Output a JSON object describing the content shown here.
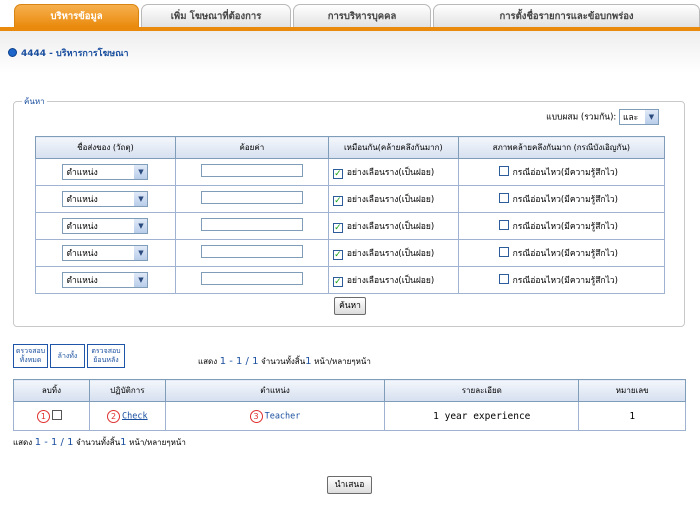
{
  "tabs": [
    {
      "label": "บริหารข้อมูล",
      "active": true
    },
    {
      "label": "เพิ่ม โฆษณาที่ต้องการ",
      "active": false
    },
    {
      "label": "การบริหารบุคคล",
      "active": false
    },
    {
      "label": "การตั้งชื่อรายการและข้อบกพร่อง",
      "active": false
    }
  ],
  "breadcrumb": "4444 - บริหารการโฆษณา",
  "search": {
    "legend": "ค้นหา",
    "mode_label": "แบบผสม (รวมกัน):",
    "mode_value": "และ",
    "headers": [
      "ชื่อส่งของ (วัถตุ)",
      "ค้อยค่า",
      "เหมือนกัน(คล้ายคลึงกันมาก)",
      "สภาพคล้ายคลึงกันมาก (กรณีบังเอิญกัน)"
    ],
    "rows": [
      {
        "field": "ตำแหน่ง",
        "similar": "อย่างเลือนราง(เป็นฝอย)",
        "similar_checked": true,
        "sensitive": "กรณีอ่อนไหว(มีความรู้สึกไว)",
        "sensitive_checked": false
      },
      {
        "field": "ตำแหน่ง",
        "similar": "อย่างเลือนราง(เป็นฝอย)",
        "similar_checked": true,
        "sensitive": "กรณีอ่อนไหว(มีความรู้สึกไว)",
        "sensitive_checked": false
      },
      {
        "field": "ตำแหน่ง",
        "similar": "อย่างเลือนราง(เป็นฝอย)",
        "similar_checked": true,
        "sensitive": "กรณีอ่อนไหว(มีความรู้สึกไว)",
        "sensitive_checked": false
      },
      {
        "field": "ตำแหน่ง",
        "similar": "อย่างเลือนราง(เป็นฝอย)",
        "similar_checked": true,
        "sensitive": "กรณีอ่อนไหว(มีความรู้สึกไว)",
        "sensitive_checked": false
      },
      {
        "field": "ตำแหน่ง",
        "similar": "อย่างเลือนราง(เป็นฝอย)",
        "similar_checked": true,
        "sensitive": "กรณีอ่อนไหว(มีความรู้สึกไว)",
        "sensitive_checked": false
      }
    ],
    "button": "ค้นหา"
  },
  "small_buttons": [
    {
      "label": "ตรวจสอบ ทั้งหมด"
    },
    {
      "label": "ล้างทั้ง"
    },
    {
      "label": "ตรวจสอบ ย้อนหลัง"
    }
  ],
  "paging": {
    "prefix": "แสดง",
    "range": "1 - 1 / 1",
    "total_label": "จำนวนทั้งสิ้น",
    "pages": "1",
    "suffix": "หน้า/หลายๆหน้า"
  },
  "results": {
    "headers": [
      "ลบทิ้ง",
      "ปฏิบัติการ",
      "ตำแหน่ง",
      "รายละเอียด",
      "หมายเลข"
    ],
    "rows": [
      {
        "mark1": "1",
        "mark2": "2",
        "action": "Check",
        "mark3": "3",
        "position": "Teacher",
        "detail": "1 year experience",
        "number": "1"
      }
    ]
  },
  "submit": "นำเสนอ",
  "colors": {
    "tab_active": "#e98a0d",
    "link": "#1a4f9f",
    "border": "#7f9db9"
  }
}
